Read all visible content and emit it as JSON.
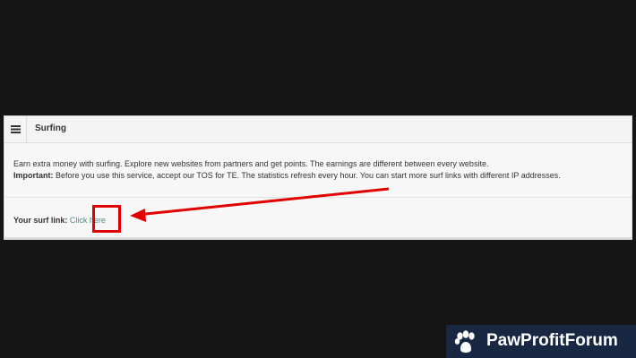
{
  "panel": {
    "title": "Surfing",
    "menu_icon": "menu-icon",
    "line1": "Earn extra money with surfing. Explore new websites from partners and get points. The earnings are different between every website.",
    "important_label": "Important:",
    "important_text": " Before you use this service, accept our TOS for TE. The statistics refresh every hour. You can start more surf links with different IP addresses.",
    "surf_label": "Your surf link:",
    "surf_link_text": "Click here"
  },
  "annotation": {
    "color": "#e10000",
    "arrow_icon": "red-arrow"
  },
  "brand": {
    "text": "PawProfitForum",
    "icon": "paw-icon",
    "color": "#182742"
  }
}
